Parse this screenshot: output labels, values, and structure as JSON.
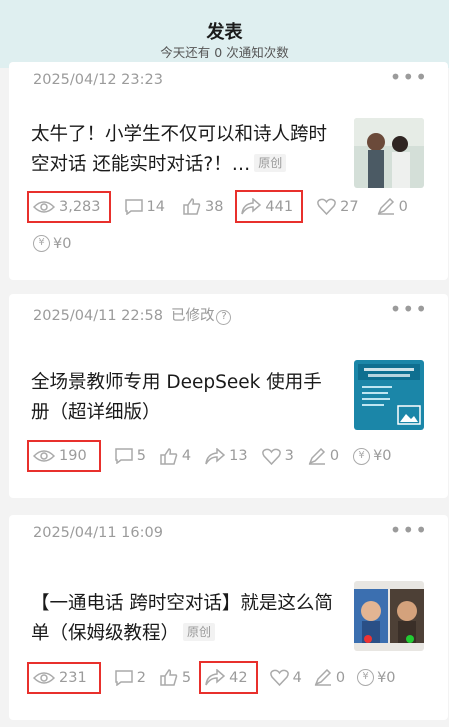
{
  "header": {
    "title": "发表",
    "subtitle": "今天还有 0 次通知次数"
  },
  "posts": [
    {
      "date": "2025/04/12 23:23",
      "title": "太牛了！小学生不仅可以和诗人跨时空对话 还能实时对话?！…",
      "tag": "原创",
      "stats": {
        "views": "3,283",
        "comments": "14",
        "likes": "38",
        "shares": "441",
        "favorites": "27",
        "edits": "0",
        "reward": "¥0"
      },
      "thumb_bg": "#cfd8d4"
    },
    {
      "date": "2025/04/11 22:58",
      "modified": "已修改",
      "title": "全场景教师专用 DeepSeek 使用手册（超详细版）",
      "stats": {
        "views": "190",
        "comments": "5",
        "likes": "4",
        "shares": "13",
        "favorites": "3",
        "edits": "0",
        "reward": "¥0"
      },
      "thumb_bg": "#1a7fa2"
    },
    {
      "date": "2025/04/11 16:09",
      "title": "【一通电话 跨时空对话】就是这么简单（保姆级教程）",
      "tag": "原创",
      "stats": {
        "views": "231",
        "comments": "2",
        "likes": "5",
        "shares": "42",
        "favorites": "4",
        "edits": "0",
        "reward": "¥0"
      },
      "thumb_bg": "#2e3a3a"
    }
  ],
  "icons": {
    "views": "eye-icon",
    "comments": "comment-icon",
    "likes": "thumb-up-icon",
    "shares": "share-icon",
    "favorites": "heart-icon",
    "edits": "pen-icon",
    "reward": "yen-icon",
    "more": "more-icon"
  },
  "colors": {
    "highlight": "#e8302c",
    "header_bg": "#dfeff0",
    "muted": "#9b9b9b"
  }
}
